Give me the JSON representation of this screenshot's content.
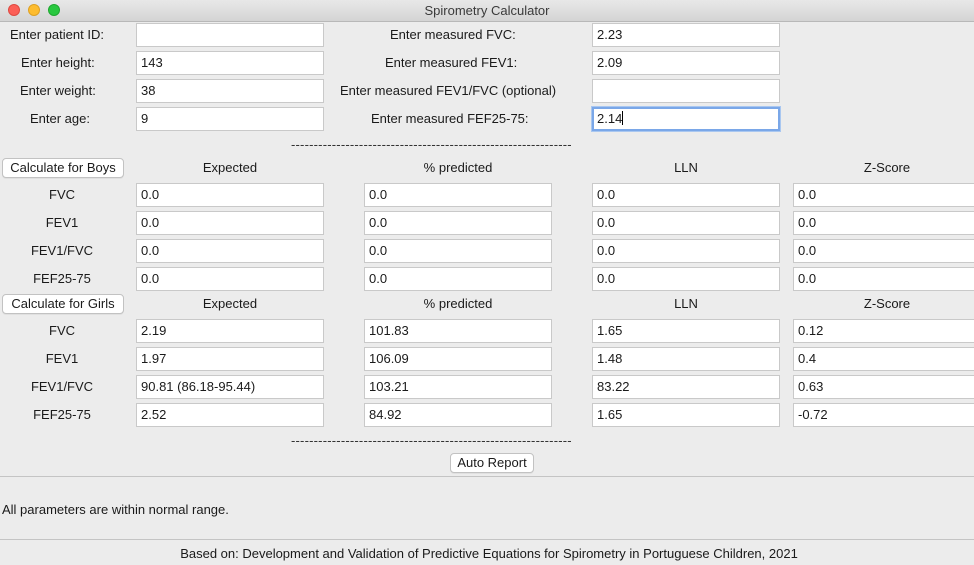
{
  "window": {
    "title": "Spirometry Calculator"
  },
  "inputs": {
    "patient_id_label": "Enter patient ID:",
    "patient_id_value": "",
    "height_label": "Enter height:",
    "height_value": "143",
    "weight_label": "Enter weight:",
    "weight_value": "38",
    "age_label": "Enter age:",
    "age_value": "9",
    "fvc_label": "Enter measured FVC:",
    "fvc_value": "2.23",
    "fev1_label": "Enter measured FEV1:",
    "fev1_value": "2.09",
    "ratio_label": "Enter measured FEV1/FVC (optional)",
    "ratio_value": "",
    "fef_label": "Enter measured FEF25-75:",
    "fef_value": "2.14"
  },
  "divider": "--------------------------------------------------------------",
  "headers": {
    "expected": "Expected",
    "pct": "% predicted",
    "lln": "LLN",
    "z": "Z-Score"
  },
  "boys": {
    "button": "Calculate for Boys",
    "rows": [
      {
        "label": "FVC",
        "expected": "0.0",
        "pct": "0.0",
        "lln": "0.0",
        "z": "0.0"
      },
      {
        "label": "FEV1",
        "expected": "0.0",
        "pct": "0.0",
        "lln": "0.0",
        "z": "0.0"
      },
      {
        "label": "FEV1/FVC",
        "expected": "0.0",
        "pct": "0.0",
        "lln": "0.0",
        "z": "0.0"
      },
      {
        "label": "FEF25-75",
        "expected": "0.0",
        "pct": "0.0",
        "lln": "0.0",
        "z": "0.0"
      }
    ]
  },
  "girls": {
    "button": "Calculate for Girls",
    "rows": [
      {
        "label": "FVC",
        "expected": "2.19",
        "pct": "101.83",
        "lln": "1.65",
        "z": "0.12"
      },
      {
        "label": "FEV1",
        "expected": "1.97",
        "pct": "106.09",
        "lln": "1.48",
        "z": "0.4"
      },
      {
        "label": "FEV1/FVC",
        "expected": "90.81 (86.18-95.44)",
        "pct": "103.21",
        "lln": "83.22",
        "z": "0.63"
      },
      {
        "label": "FEF25-75",
        "expected": "2.52",
        "pct": "84.92",
        "lln": "1.65",
        "z": "-0.72"
      }
    ]
  },
  "report": {
    "button": "Auto Report",
    "text": "All parameters are within normal range."
  },
  "footer": "Based on: Development and Validation of Predictive Equations for Spirometry in Portuguese Children, 2021",
  "colors": {
    "close": "#fc5f57",
    "minimize": "#fdbc2e",
    "maximize": "#29c840",
    "focus_ring": "#7aa7e8"
  }
}
